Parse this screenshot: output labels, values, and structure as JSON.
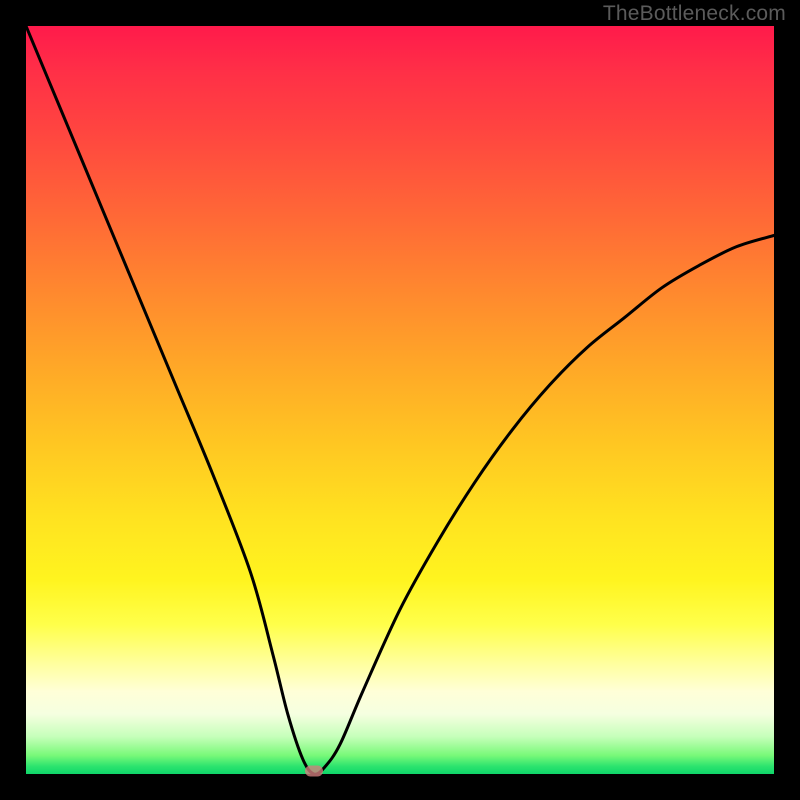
{
  "watermark": "TheBottleneck.com",
  "chart_data": {
    "type": "line",
    "title": "",
    "xlabel": "",
    "ylabel": "",
    "xlim": [
      0,
      100
    ],
    "ylim": [
      0,
      100
    ],
    "grid": false,
    "legend": false,
    "x": [
      0,
      5,
      10,
      15,
      20,
      25,
      30,
      33,
      35,
      37,
      38.5,
      40,
      42,
      45,
      50,
      55,
      60,
      65,
      70,
      75,
      80,
      85,
      90,
      95,
      100
    ],
    "values": [
      100,
      88,
      76,
      64,
      52,
      40,
      27,
      16,
      8,
      2,
      0,
      1,
      4,
      11,
      22,
      31,
      39,
      46,
      52,
      57,
      61,
      65,
      68,
      70.5,
      72
    ],
    "minimum_marker": {
      "x": 38.5,
      "y": 0
    },
    "colors": {
      "curve": "#000000",
      "gradient_top": "#ff1a4b",
      "gradient_bottom": "#0fd66a",
      "marker": "#d47d7d",
      "frame": "#000000"
    }
  }
}
